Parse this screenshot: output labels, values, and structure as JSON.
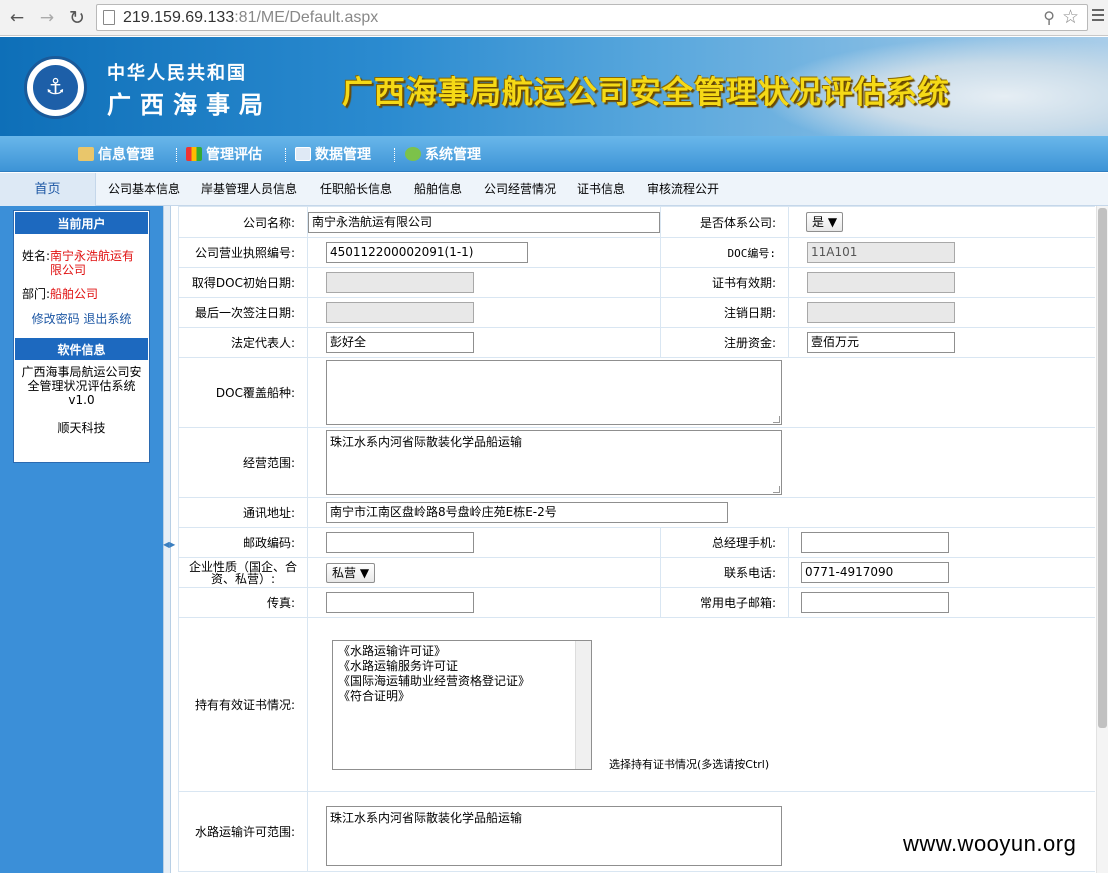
{
  "browser": {
    "url": "219.159.69.133:81/ME/Default.aspx",
    "url_host": "219.159.69.133",
    "url_rest": ":81/ME/Default.aspx"
  },
  "header": {
    "org_line1": "中华人民共和国",
    "org_line2": "广西海事局",
    "system_title": "广西海事局航运公司安全管理状况评估系统",
    "logo_text": "CHINA MSA",
    "brand_color": "#f5d916"
  },
  "top_nav": {
    "items": [
      {
        "label": "信息管理",
        "icon": "info-manage-icon"
      },
      {
        "label": "管理评估",
        "icon": "chart-bar-icon"
      },
      {
        "label": "数据管理",
        "icon": "table-icon"
      },
      {
        "label": "系统管理",
        "icon": "gear-icon"
      }
    ]
  },
  "sub_nav": {
    "home": "首页",
    "items": [
      "公司基本信息",
      "岸基管理人员信息",
      "任职船长信息",
      "船舶信息",
      "公司经营情况",
      "证书信息",
      "审核流程公开"
    ]
  },
  "sidebar": {
    "current_user_title": "当前用户",
    "name_label": "姓名:",
    "name_value": "南宁永浩航运有限公司",
    "dept_label": "部门:",
    "dept_value": "船舶公司",
    "change_password": "修改密码",
    "logout": "退出系统",
    "software_title": "软件信息",
    "software_name": "广西海事局航运公司安全管理状况评估系统",
    "version": "v1.0",
    "vendor": "顺天科技"
  },
  "form": {
    "company_name_label": "公司名称:",
    "company_name": "南宁永浩航运有限公司",
    "is_system_label": "是否体系公司:",
    "is_system_value": "是",
    "license_no_label": "公司营业执照编号:",
    "license_no": "450112200002091(1-1)",
    "doc_no_label": "DOC编号:",
    "doc_no": "11A101",
    "doc_init_date_label": "取得DOC初始日期:",
    "doc_init_date": "",
    "cert_valid_label": "证书有效期:",
    "cert_valid": "",
    "last_endorse_label": "最后一次签注日期:",
    "last_endorse": "",
    "cancel_date_label": "注销日期:",
    "cancel_date": "",
    "legal_rep_label": "法定代表人:",
    "legal_rep": "彭好全",
    "reg_capital_label": "注册资金:",
    "reg_capital": "壹佰万元",
    "doc_ship_types_label": "DOC覆盖船种:",
    "doc_ship_types": "",
    "business_scope_label": "经营范围:",
    "business_scope": "珠江水系内河省际散装化学品船运输",
    "address_label": "通讯地址:",
    "address": "南宁市江南区盘岭路8号盘岭庄苑E栋E-2号",
    "postcode_label": "邮政编码:",
    "postcode": "",
    "gm_mobile_label": "总经理手机:",
    "gm_mobile": "",
    "nature_label": "企业性质（国企、合资、私营）:",
    "nature_value": "私营",
    "phone_label": "联系电话:",
    "phone": "0771-4917090",
    "fax_label": "传真:",
    "fax": "",
    "email_label": "常用电子邮箱:",
    "email": "",
    "certs_label": "持有有效证书情况:",
    "certs_options": [
      "《水路运输许可证》",
      "《水路运输服务许可证",
      "《国际海运辅助业经营资格登记证》",
      "《符合证明》"
    ],
    "certs_hint": "选择持有证书情况(多选请按Ctrl)",
    "water_scope_label": "水路运输许可范围:",
    "water_scope": "珠江水系内河省际散装化学品船运输"
  },
  "watermark": "www.wooyun.org"
}
